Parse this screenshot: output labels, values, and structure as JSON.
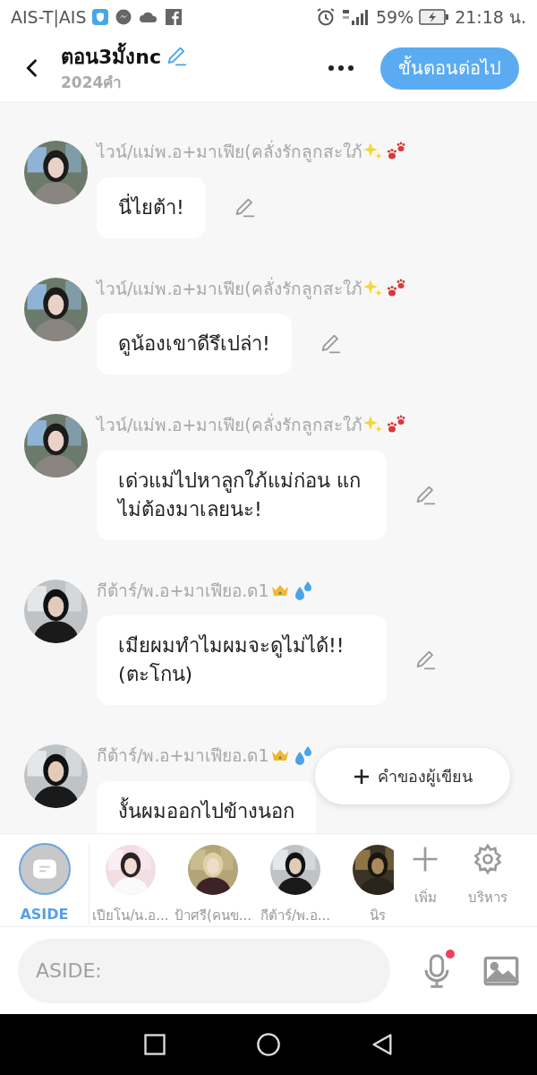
{
  "status_bar": {
    "carrier": "AIS-T|AIS",
    "battery": "59%",
    "time": "21:18 น."
  },
  "header": {
    "title": "ตอน3มั้งnc",
    "word_count": "2024คำ",
    "next_button": "ขั้นตอนต่อไป"
  },
  "messages": [
    {
      "kind": "woman",
      "speaker": "ไวน์/แม่พ.อ+มาเฟีย(คลั่งรักลูกสะใภ้",
      "text": "นี่ไยต้า!"
    },
    {
      "kind": "woman",
      "speaker": "ไวน์/แม่พ.อ+มาเฟีย(คลั่งรักลูกสะใภ้",
      "text": "ดูน้องเขาดีรึเปล่า!"
    },
    {
      "kind": "woman",
      "speaker": "ไวน์/แม่พ.อ+มาเฟีย(คลั่งรักลูกสะใภ้",
      "text": "เด่วแม่ไปหาลูกใภ้แม่ก่อน แกไม่ต้องมาเลยนะ!"
    },
    {
      "kind": "man",
      "speaker": "กีต้าร์/พ.อ+มาเฟียอ.ด1",
      "text": "เมียผมทำไมผมจะดูไม่ได้!! (ตะโกน)"
    },
    {
      "kind": "man",
      "speaker": "กีต้าร์/พ.อ+มาเฟียอ.ด1",
      "text": "งั้นผมออกไปข้างนอก"
    }
  ],
  "author_note_button": "คำของผู้เขียน",
  "characters": [
    {
      "kind": "aside",
      "label": "ASIDE",
      "selected": true
    },
    {
      "kind": "character",
      "label": "เปียโน/น.อ...",
      "selected": false
    },
    {
      "kind": "character",
      "label": "ป้าศรี(คนข...",
      "selected": false
    },
    {
      "kind": "character",
      "label": "กีต้าร์/พ.อ...",
      "selected": false
    },
    {
      "kind": "character",
      "label": "นิร",
      "selected": false
    }
  ],
  "character_actions": [
    {
      "kind": "add",
      "label": "เพิ่ม"
    },
    {
      "kind": "manage",
      "label": "บริหาร"
    }
  ],
  "input": {
    "placeholder": "ASIDE:",
    "mic_notification": true
  }
}
